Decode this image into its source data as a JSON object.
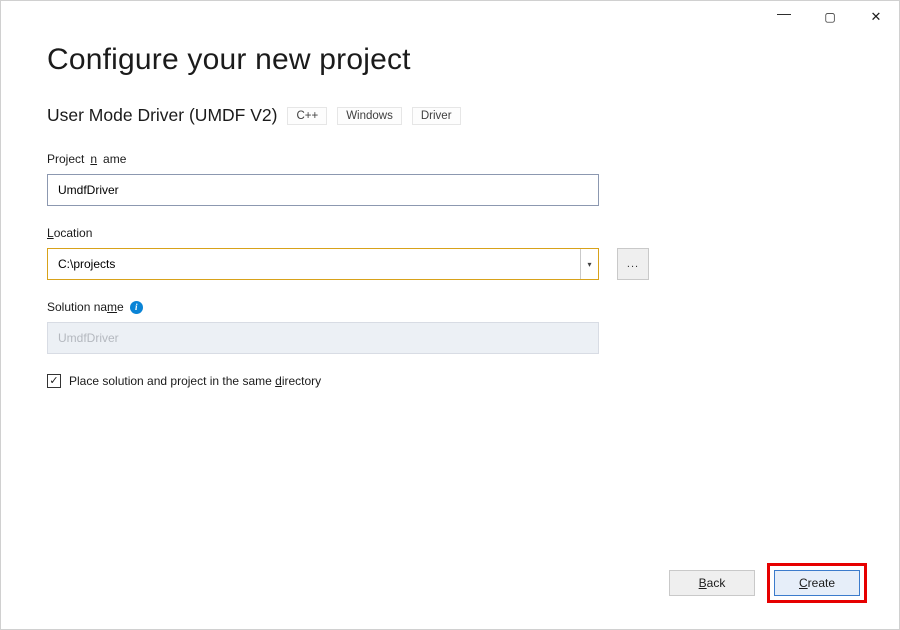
{
  "window": {
    "minimize_glyph": "—",
    "maximize_glyph": "▢",
    "close_glyph": "✕"
  },
  "title": "Configure your new project",
  "template": {
    "name": "User Mode Driver (UMDF V2)",
    "tags": [
      "C++",
      "Windows",
      "Driver"
    ]
  },
  "fields": {
    "project_name": {
      "label_pre": "Project ",
      "label_u": "n",
      "label_post": "ame",
      "value": "UmdfDriver"
    },
    "location": {
      "label_u": "L",
      "label_post": "ocation",
      "value": "C:\\projects",
      "browse": "..."
    },
    "solution_name": {
      "label_pre": "Solution na",
      "label_u": "m",
      "label_post": "e",
      "value": "UmdfDriver"
    },
    "same_dir": {
      "checked_glyph": "✓",
      "label_pre": "Place solution and project in the same ",
      "label_u": "d",
      "label_post": "irectory"
    }
  },
  "buttons": {
    "back_u": "B",
    "back_post": "ack",
    "create_u": "C",
    "create_post": "reate"
  }
}
